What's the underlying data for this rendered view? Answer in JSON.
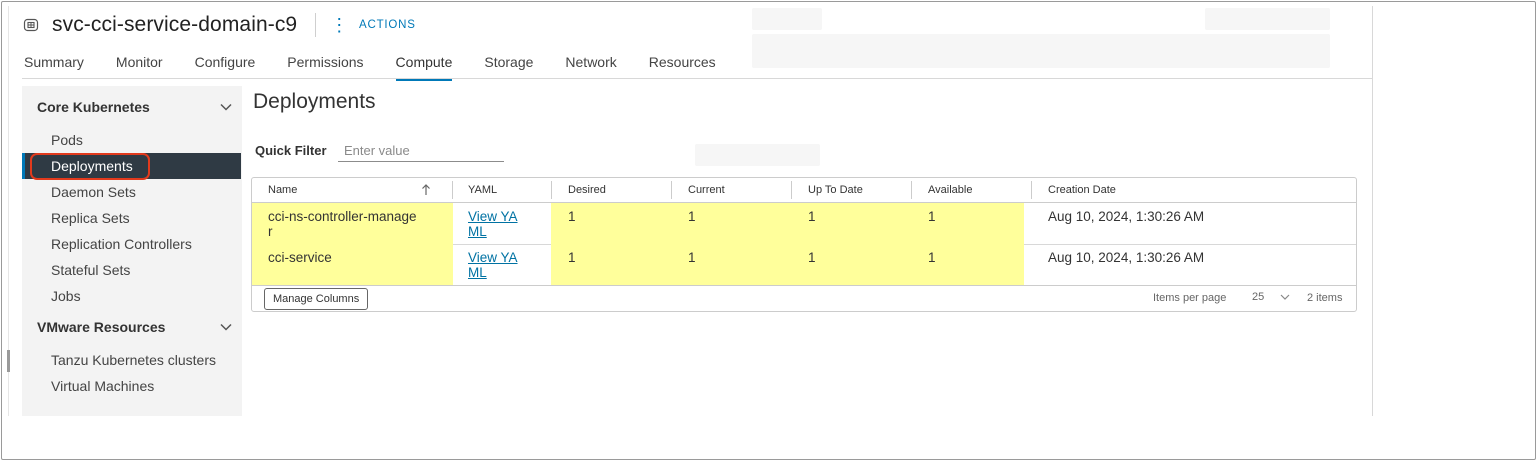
{
  "header": {
    "title": "svc-cci-service-domain-c9",
    "actions_label": "ACTIONS",
    "icon": "namespace-icon"
  },
  "tabs": [
    {
      "label": "Summary"
    },
    {
      "label": "Monitor"
    },
    {
      "label": "Configure"
    },
    {
      "label": "Permissions"
    },
    {
      "label": "Compute",
      "active": true
    },
    {
      "label": "Storage"
    },
    {
      "label": "Network"
    },
    {
      "label": "Resources"
    }
  ],
  "sidebar": {
    "groups": [
      {
        "label": "Core Kubernetes",
        "items": [
          "Pods",
          "Deployments",
          "Daemon Sets",
          "Replica Sets",
          "Replication Controllers",
          "Stateful Sets",
          "Jobs"
        ]
      },
      {
        "label": "VMware Resources",
        "items": [
          "Tanzu Kubernetes clusters",
          "Virtual Machines"
        ]
      }
    ],
    "selected": "Deployments"
  },
  "main": {
    "title": "Deployments",
    "quick_filter_label": "Quick Filter",
    "quick_filter_placeholder": "Enter value"
  },
  "table": {
    "columns": [
      "Name",
      "YAML",
      "Desired",
      "Current",
      "Up To Date",
      "Available",
      "Creation Date"
    ],
    "sort_column": "Name",
    "rows": [
      {
        "name_line1": "cci-ns-controller-manage",
        "name_line2": "r",
        "yaml_line1": "View YA",
        "yaml_line2": "ML",
        "desired": "1",
        "current": "1",
        "up_to_date": "1",
        "available": "1",
        "created": "Aug 10, 2024, 1:30:26 AM"
      },
      {
        "name_line1": "cci-service",
        "name_line2": "",
        "yaml_line1": "View YA",
        "yaml_line2": "ML",
        "desired": "1",
        "current": "1",
        "up_to_date": "1",
        "available": "1",
        "created": "Aug 10, 2024, 1:30:26 AM"
      }
    ],
    "footer": {
      "manage_columns_label": "Manage Columns",
      "items_per_page_label": "Items per page",
      "page_size": "25",
      "total_label": "2 items"
    }
  },
  "colors": {
    "accent": "#0079b8",
    "selected_nav_bg": "#2f3a44",
    "row_highlight": "#ffff9b",
    "callout": "#e23a1d"
  }
}
